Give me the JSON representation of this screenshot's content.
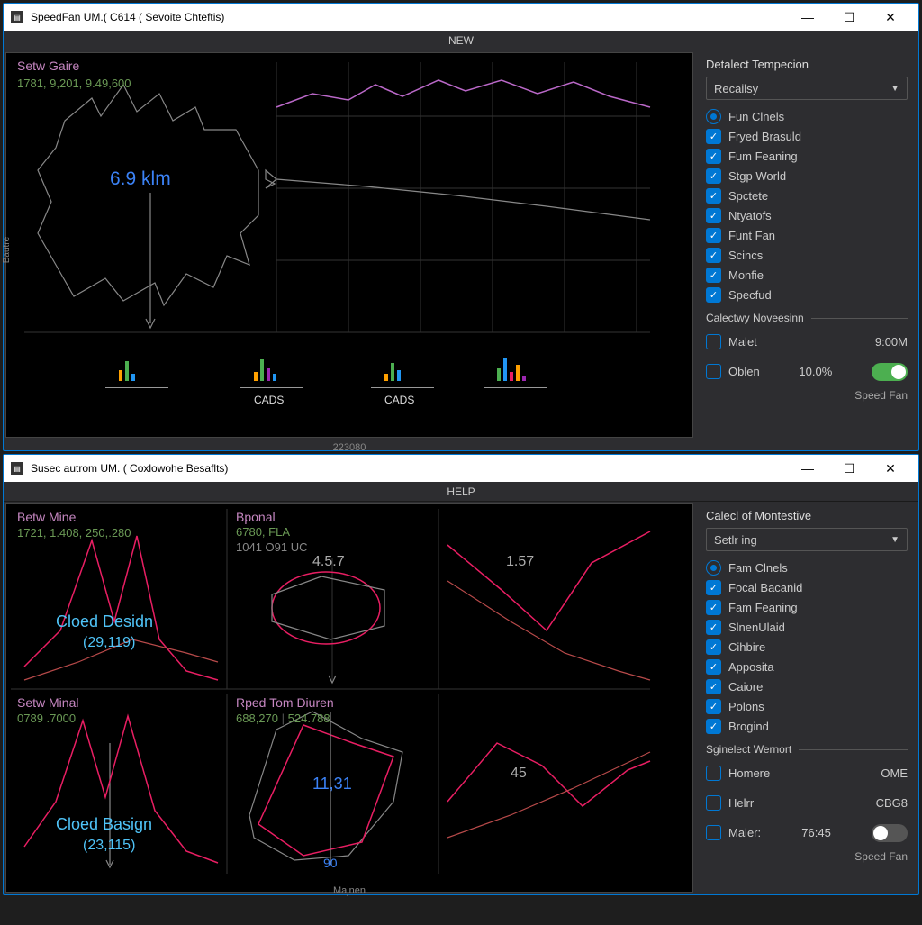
{
  "win1": {
    "title": "SpeedFan UM.( C614 ( Sevoite Chteftis)",
    "menu": "NEW",
    "chart": {
      "title": "Setw Gaire",
      "nums": "1781, 9,201, 9.49,600",
      "center": "6.9 klm",
      "cads1": "CADS",
      "cads2": "CADS",
      "xaxis": "223080",
      "yaxis": "Bautre"
    },
    "side": {
      "title": "Detalect Tempecion",
      "select": "Recailsy",
      "items": [
        "Fun Clnels",
        "Fryed Brasuld",
        "Fum Feaning",
        "Stgp World",
        "Spctete",
        "Ntyatofs",
        "Funt Fan",
        "Scincs",
        "Monfie",
        "Specfud"
      ],
      "section": "Calectwy Noveesinn",
      "malet": "Malet",
      "malet_v": "9:00M",
      "oblen": "Oblen",
      "oblen_v": "10.0%",
      "brand": "Speed Fan"
    }
  },
  "win2": {
    "title": "Susec autrom UM. ( Coxlowohe Besaflts)",
    "menu": "HELP",
    "charts": {
      "a": {
        "title": "Betw Mine",
        "nums": "1721, 1.408, 250,.280",
        "big": "Cloed Desidn",
        "sub": "(29,119)"
      },
      "b": {
        "title": "Bponal",
        "nums": "6780, FLA",
        "nums2": "1041 O91 UC",
        "center": "4.5.7"
      },
      "c": {
        "num": "1.57"
      },
      "d": {
        "title": "Setw Minal",
        "nums": "0789 .7000",
        "big": "Cloed Basign",
        "sub": "(23,115)"
      },
      "e": {
        "title": "Rped Tom Diuren",
        "nums": "688,270 | 524.788",
        "center": "11,31",
        "bottom": "90"
      },
      "f": {
        "num": "45"
      },
      "xaxis": "Majnen"
    },
    "side": {
      "title": "Calecl of Montestive",
      "select": "Setlr ing",
      "items": [
        "Fam Clnels",
        "Focal Bacanid",
        "Fam Feaning",
        "SlnenUlaid",
        "Cihbire",
        "Apposita",
        "Caiore",
        "Polons",
        "Brogind"
      ],
      "section": "Sginelect Wernort",
      "homere": "Homere",
      "homere_v": "OME",
      "helrr": "Helrr",
      "helrr_v": "CBG8",
      "maler": "Maler:",
      "maler_v": "76:45",
      "brand": "Speed Fan"
    }
  }
}
